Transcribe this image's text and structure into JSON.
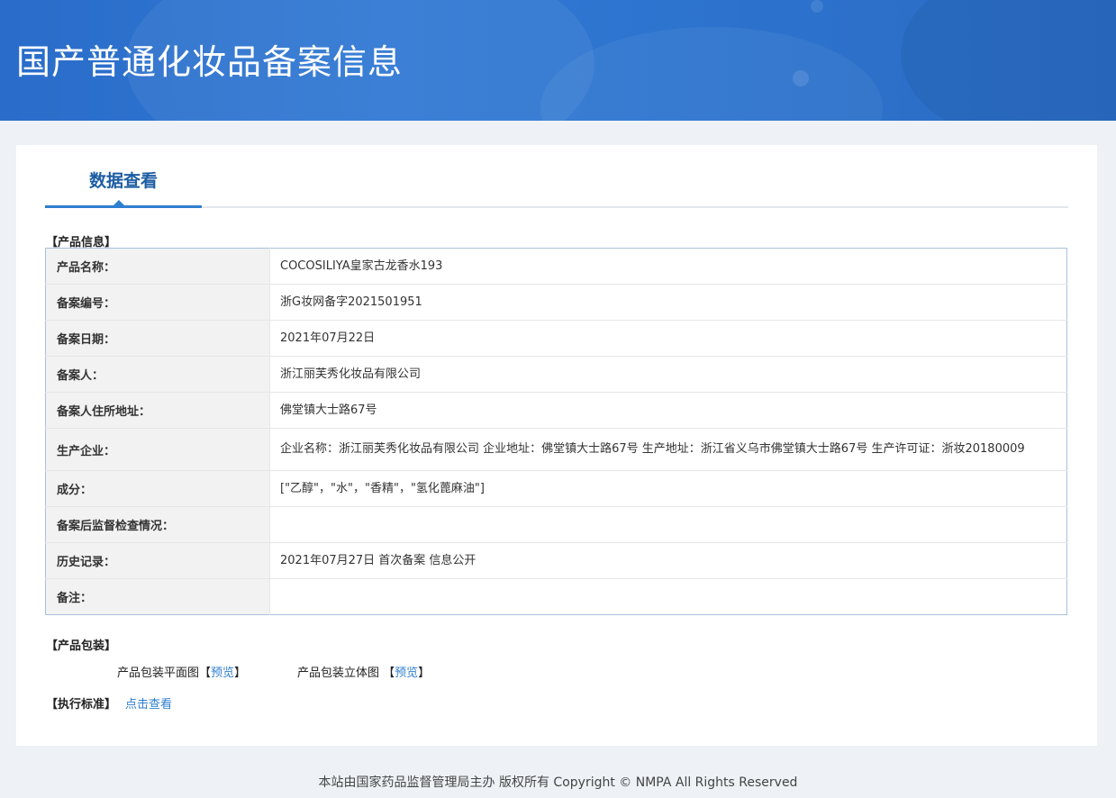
{
  "page_title": "国产普通化妆品备案信息",
  "tab_label": "数据查看",
  "sections": {
    "product_info": "【产品信息】",
    "product_packaging": "【产品包装】",
    "exec_standard": "【执行标准】"
  },
  "info_rows": [
    {
      "key": "产品名称：",
      "value": "COCOSILIYA皇家古龙香水193"
    },
    {
      "key": "备案编号：",
      "value": "浙G妆网备字2021501951"
    },
    {
      "key": "备案日期：",
      "value": "2021年07月22日"
    },
    {
      "key": "备案人：",
      "value": "浙江丽芙秀化妆品有限公司"
    },
    {
      "key": "备案人住所地址：",
      "value": "佛堂镇大士路67号"
    },
    {
      "key": "生产企业：",
      "value": "企业名称：浙江丽芙秀化妆品有限公司 企业地址：佛堂镇大士路67号 生产地址：浙江省义乌市佛堂镇大士路67号 生产许可证：浙妆20180009"
    },
    {
      "key": "成分：",
      "value": "[\"乙醇\"，\"水\"，\"香精\"，\"氢化蓖麻油\"]"
    },
    {
      "key": "备案后监督检查情况：",
      "value": ""
    },
    {
      "key": "历史记录：",
      "value": "2021年07月27日 首次备案 信息公开"
    },
    {
      "key": "备注：",
      "value": ""
    }
  ],
  "packaging": {
    "flat_label": "产品包装平面图",
    "flat_link_open": "【",
    "flat_link": "预览",
    "flat_link_close": "】",
    "stereo_label": "产品包装立体图 ",
    "stereo_link_open": "【",
    "stereo_link": "预览",
    "stereo_link_close": "】"
  },
  "exec_standard_link": "点击查看",
  "footer": "本站由国家药品监督管理局主办 版权所有 Copyright © NMPA All Rights Reserved"
}
